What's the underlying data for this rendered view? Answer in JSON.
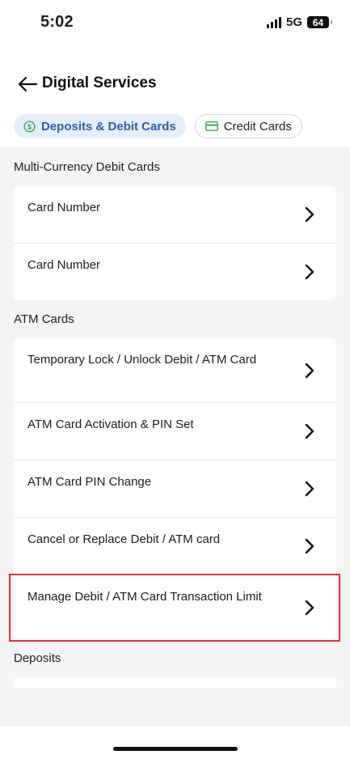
{
  "status_bar": {
    "time": "5:02",
    "network": "5G",
    "battery": "64"
  },
  "header": {
    "title": "Digital Services",
    "back_icon": "arrow-left-icon"
  },
  "tabs": [
    {
      "label": "Deposits & Debit Cards",
      "active": true,
      "icon": "dollar-coin-icon"
    },
    {
      "label": "Credit Cards",
      "active": false,
      "icon": "credit-card-icon"
    }
  ],
  "sections": [
    {
      "title": "Multi-Currency Debit Cards",
      "items": [
        {
          "label": "Card Number"
        },
        {
          "label": "Card Number"
        }
      ]
    },
    {
      "title": "ATM Cards",
      "items": [
        {
          "label": "Temporary Lock / Unlock Debit / ATM Card"
        },
        {
          "label": "ATM Card Activation & PIN Set"
        },
        {
          "label": "ATM Card PIN Change"
        },
        {
          "label": "Cancel or Replace Debit / ATM card"
        },
        {
          "label": "Manage Debit / ATM Card Transaction Limit"
        }
      ]
    },
    {
      "title": "Deposits",
      "items": []
    }
  ],
  "colors": {
    "accent": "#2f5fa8",
    "tab_active_bg": "#e6eef8",
    "highlight": "#d9363e",
    "content_bg": "#f4f4f4"
  }
}
